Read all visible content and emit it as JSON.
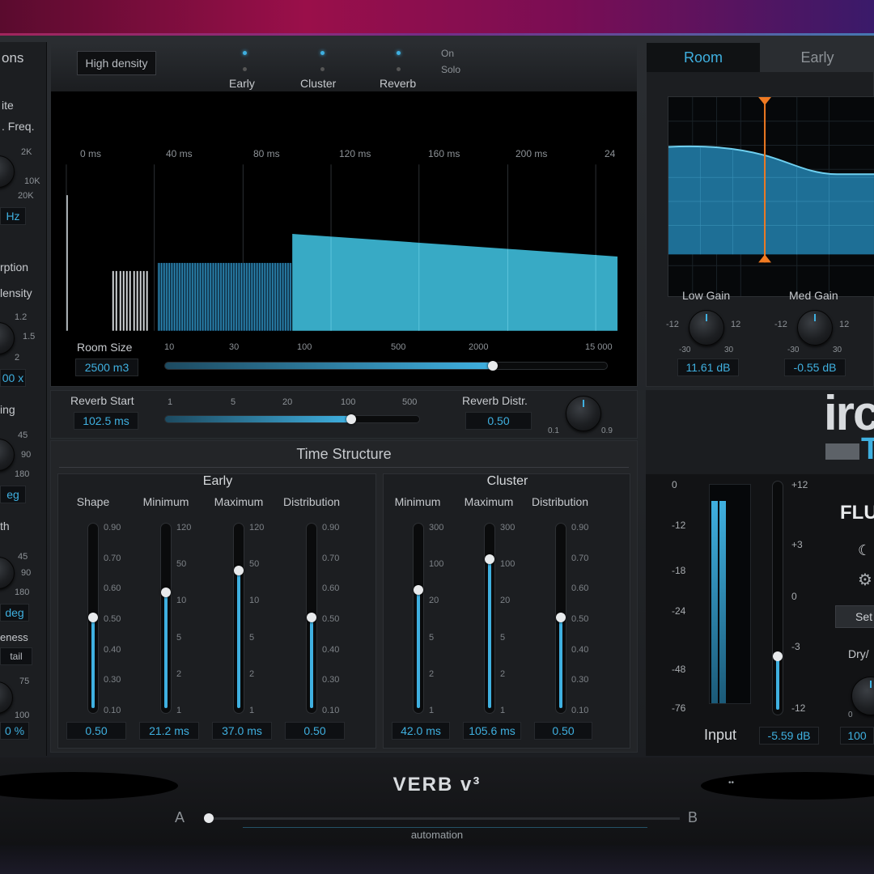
{
  "left_strip": {
    "items": [
      "ons",
      "ite",
      ". Freq.",
      "2K",
      "10K",
      "20K",
      "Hz",
      "rption",
      "lensity",
      "1.2",
      "1.5",
      "2",
      "00 x",
      "ing",
      "45",
      "90",
      "180",
      "eg",
      "th",
      "45",
      "90",
      "180",
      "deg",
      "eness",
      "tail",
      "75",
      "100",
      "0 %"
    ]
  },
  "timeline": {
    "high_density_label": "High density",
    "outputs": [
      {
        "label": "Early"
      },
      {
        "label": "Cluster"
      },
      {
        "label": "Reverb"
      }
    ],
    "on_label": "On",
    "solo_label": "Solo",
    "time_labels": [
      "0 ms",
      "40 ms",
      "80 ms",
      "120 ms",
      "160 ms",
      "200 ms",
      "24"
    ],
    "room_size_label": "Room Size",
    "room_size_value": "2500 m3",
    "room_ticks": [
      "10",
      "30",
      "100",
      "500",
      "2000",
      "15 000"
    ],
    "room_slider_fraction": 0.74
  },
  "reverb_start": {
    "label": "Reverb Start",
    "value": "102.5 ms",
    "ticks": [
      "1",
      "5",
      "20",
      "100",
      "500"
    ],
    "slider_fraction": 0.73,
    "distr_label": "Reverb Distr.",
    "distr_value": "0.50",
    "distr_min": "0.1",
    "distr_max": "0.9"
  },
  "time_structure": {
    "title": "Time Structure",
    "early": {
      "title": "Early",
      "faders": [
        {
          "label": "Shape",
          "value": "0.50",
          "ticks": [
            "0.90",
            "0.70",
            "0.60",
            "0.50",
            "0.40",
            "0.30",
            "0.10"
          ],
          "level": 0.5
        },
        {
          "label": "Minimum",
          "value": "21.2 ms",
          "ticks": [
            "120",
            "50",
            "10",
            "5",
            "2",
            "1"
          ],
          "level": 0.64
        },
        {
          "label": "Maximum",
          "value": "37.0 ms",
          "ticks": [
            "120",
            "50",
            "10",
            "5",
            "2",
            "1"
          ],
          "level": 0.76
        },
        {
          "label": "Distribution",
          "value": "0.50",
          "ticks": [
            "0.90",
            "0.70",
            "0.60",
            "0.50",
            "0.40",
            "0.30",
            "0.10"
          ],
          "level": 0.5
        }
      ]
    },
    "cluster": {
      "title": "Cluster",
      "faders": [
        {
          "label": "Minimum",
          "value": "42.0 ms",
          "ticks": [
            "300",
            "100",
            "20",
            "5",
            "2",
            "1"
          ],
          "level": 0.65
        },
        {
          "label": "Maximum",
          "value": "105.6 ms",
          "ticks": [
            "300",
            "100",
            "20",
            "5",
            "2",
            "1"
          ],
          "level": 0.82
        },
        {
          "label": "Distribution",
          "value": "0.50",
          "ticks": [
            "0.90",
            "0.70",
            "0.60",
            "0.50",
            "0.40",
            "0.30",
            "0.10"
          ],
          "level": 0.5
        }
      ]
    }
  },
  "eq": {
    "tabs": [
      "Room",
      "Early"
    ],
    "low_gain_label": "Low Gain",
    "low_gain_value": "11.61 dB",
    "med_gain_label": "Med Gain",
    "med_gain_value": "-0.55 dB",
    "knob_ticks": {
      "left": "-12",
      "right": "12",
      "bottom_left": "-30",
      "bottom_right": "30"
    }
  },
  "brand": {
    "text": "irca",
    "sub": "T",
    "flux": "FLU"
  },
  "meters": {
    "scale_left": [
      "0",
      "-12",
      "-18",
      "-24",
      "-48",
      "-76"
    ],
    "scale_right": [
      "+12",
      "+3",
      "0",
      "-3",
      "-12"
    ],
    "input_label": "Input",
    "input_value": "-5.59 dB",
    "input_level": 0.24,
    "set_label": "Set",
    "dry_wet_label": "Dry/",
    "dry_wet_value": "100",
    "dry_wet_min": "0"
  },
  "bottom": {
    "product": "VERB v³",
    "a_label": "A",
    "b_label": "B",
    "automation_label": "automation",
    "right_dots": "••"
  },
  "colors": {
    "accent": "#3fb0e0",
    "teal_fill": "#38aac5",
    "eq_marker": "#f07a22"
  }
}
